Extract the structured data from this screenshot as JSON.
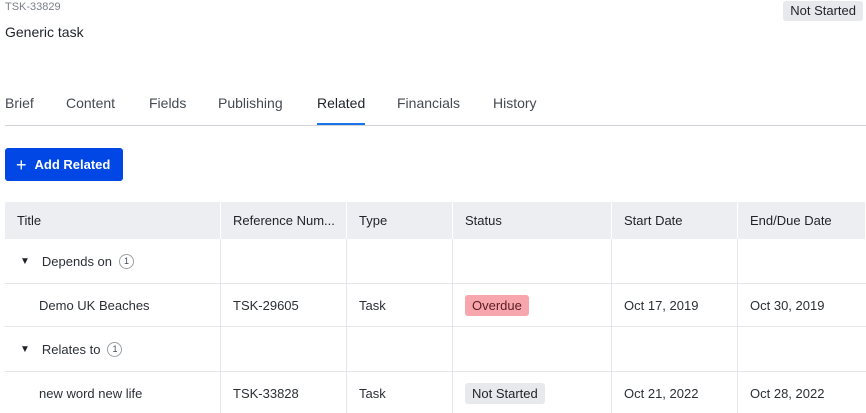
{
  "task": {
    "id": "TSK-33829",
    "title": "Generic task",
    "status": "Not Started"
  },
  "tabs": [
    {
      "label": "Brief"
    },
    {
      "label": "Content"
    },
    {
      "label": "Fields"
    },
    {
      "label": "Publishing"
    },
    {
      "label": "Related",
      "active": true
    },
    {
      "label": "Financials"
    },
    {
      "label": "History"
    }
  ],
  "add_button": {
    "label": "Add Related",
    "icon": "plus-icon"
  },
  "table": {
    "columns": [
      "Title",
      "Reference Num...",
      "Type",
      "Status",
      "Start Date",
      "End/Due Date"
    ],
    "groups": [
      {
        "label": "Depends on",
        "count": "1",
        "rows": [
          {
            "title": "Demo UK Beaches",
            "reference": "TSK-29605",
            "type": "Task",
            "status": "Overdue",
            "start": "Oct 17, 2019",
            "end": "Oct 30, 2019"
          }
        ]
      },
      {
        "label": "Relates to",
        "count": "1",
        "rows": [
          {
            "title": "new word new life",
            "reference": "TSK-33828",
            "type": "Task",
            "status": "Not Started",
            "start": "Oct 21, 2022",
            "end": "Oct 28, 2022"
          }
        ]
      }
    ]
  },
  "colors": {
    "accent": "#0047e6",
    "tab_underline": "#1a73e8",
    "overdue": "#f7a6ad",
    "neutral_badge": "#e8e9ec"
  }
}
